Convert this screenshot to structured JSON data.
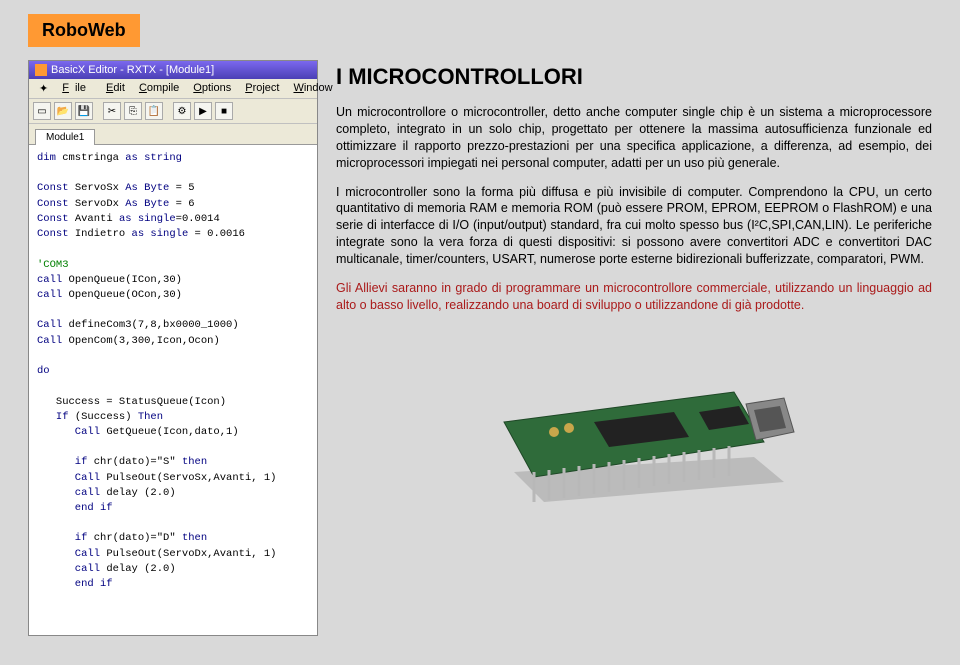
{
  "tab_title": "RoboWeb",
  "editor": {
    "window_title": "BasicX Editor - RXTX - [Module1]",
    "menu": {
      "file": "File",
      "edit": "Edit",
      "compile": "Compile",
      "options": "Options",
      "project": "Project",
      "window": "Window"
    },
    "file_tab": "Module1",
    "code": {
      "l1a": "dim",
      "l1b": " cmstringa ",
      "l1c": "as string",
      "l2a": "Const",
      "l2b": " ServoSx ",
      "l2c": "As Byte",
      "l2d": " = 5",
      "l3a": "Const",
      "l3b": " ServoDx ",
      "l3c": "As Byte",
      "l3d": " = 6",
      "l4a": "Const",
      "l4b": " Avanti ",
      "l4c": "as single",
      "l4d": "=0.0014",
      "l5a": "Const",
      "l5b": " Indietro ",
      "l5c": "as single",
      "l5d": " = 0.0016",
      "l6": "'COM3",
      "l7a": "call",
      "l7b": " OpenQueue(ICon,30)",
      "l8a": "call",
      "l8b": " OpenQueue(OCon,30)",
      "l9a": "Call",
      "l9b": " defineCom3(7,8,bx0000_1000)",
      "l10a": "Call",
      "l10b": " OpenCom(3,300,Icon,Ocon)",
      "l11": "do",
      "l12": "   Success = StatusQueue(Icon)",
      "l13a": "   If",
      "l13b": " (Success) ",
      "l13c": "Then",
      "l14a": "      Call",
      "l14b": " GetQueue(Icon,dato,1)",
      "l15a": "      if",
      "l15b": " chr(dato)=\"S\" ",
      "l15c": "then",
      "l16a": "      Call",
      "l16b": " PulseOut(ServoSx,Avanti, 1)",
      "l17a": "      call",
      "l17b": " delay (2.0)",
      "l18": "      end if",
      "l19a": "      if",
      "l19b": " chr(dato)=\"D\" ",
      "l19c": "then",
      "l20a": "      Call",
      "l20b": " PulseOut(ServoDx,Avanti, 1)",
      "l21a": "      call",
      "l21b": " delay (2.0)",
      "l22": "      end if"
    }
  },
  "article": {
    "heading": "I MICROCONTROLLORI",
    "p1": "Un microcontrollore o microcontroller, detto anche computer single chip è un sistema a microprocessore completo, integrato in un solo chip, progettato per ottenere la massima autosufficienza funzionale ed ottimizzare il rapporto prezzo-prestazioni per una specifica applicazione, a differenza, ad esempio, dei microprocessori impiegati nei personal computer, adatti per un uso più generale.",
    "p2": "I microcontroller sono la forma più diffusa e più invisibile di computer. Comprendono la CPU, un certo quantitativo di memoria RAM e memoria ROM (può essere PROM, EPROM, EEPROM o FlashROM) e una serie di interfacce di I/O (input/output) standard, fra cui molto spesso bus (I²C,SPI,CAN,LIN). Le periferiche integrate sono la vera forza di questi dispositivi: si possono avere convertitori ADC e convertitori DAC multicanale, timer/counters, USART, numerose porte esterne bidirezionali bufferizzate, comparatori, PWM.",
    "p3": "Gli Allievi saranno in grado di programmare un microcontrollore commerciale, utilizzando un linguaggio ad alto o basso livello, realizzando una board di sviluppo o utilizzandone di già prodotte."
  }
}
